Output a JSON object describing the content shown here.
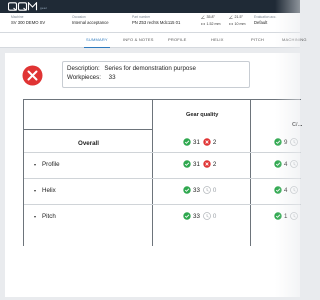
{
  "app": {
    "logo_text": "QQM",
    "logo_subtitle": "gear"
  },
  "header": {
    "machine": {
      "label": "Machine",
      "value": "SV 300 DEMO SV"
    },
    "occasion": {
      "label": "Occasion",
      "value": "Internal acceptance"
    },
    "part_number": {
      "label": "Part number",
      "value": "PN Z53 rechts Mdc115 01"
    },
    "measurements": [
      "35.8°",
      "21.5°",
      "1.52 mm",
      "10 mm"
    ],
    "evaluation": {
      "label": "Evaluation acc.",
      "value": "Default"
    }
  },
  "tabs": [
    {
      "label": "SUMMARY",
      "active": true
    },
    {
      "label": "INFO & NOTES"
    },
    {
      "label": "PROFILE"
    },
    {
      "label": "HELIX"
    },
    {
      "label": "PITCH"
    },
    {
      "label": "MACHINING"
    }
  ],
  "summary": {
    "status": "error",
    "description_label": "Description:",
    "description_value": "Series for demonstration purpose",
    "workpieces_label": "Workpieces:",
    "workpieces_value": "33"
  },
  "table": {
    "columns": [
      "Gear quality",
      "C/..."
    ],
    "rows": [
      {
        "label": "Overall",
        "bold": true,
        "gear_ok": "31",
        "gear_fail": "2",
        "c_ok": "9",
        "c_neutral": "0"
      },
      {
        "label": "Profile",
        "gear_ok": "31",
        "gear_fail": "2",
        "c_ok": "4",
        "c_neutral": "0"
      },
      {
        "label": "Helix",
        "gear_ok": "33",
        "gear_neutral": "0",
        "c_ok": "4",
        "c_neutral": "0"
      },
      {
        "label": "Pitch",
        "gear_ok": "33",
        "gear_neutral": "0",
        "c_ok": "1",
        "c_neutral": "0"
      }
    ]
  },
  "colors": {
    "topbar": "#1f2a36",
    "accent": "#2f7bbf",
    "ok": "#2fa84f",
    "fail": "#e03434",
    "neutral": "#b8bcc0"
  }
}
